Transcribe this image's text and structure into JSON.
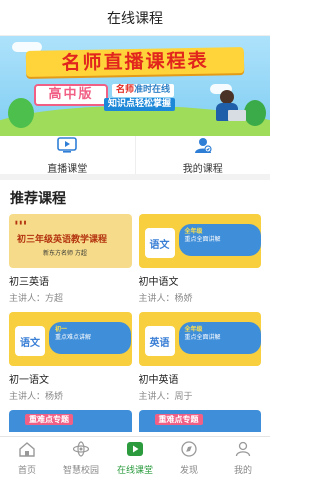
{
  "header": {
    "title": "在线课程"
  },
  "banner": {
    "headline": "名师直播课程表",
    "grade_badge": "高中版",
    "line1_prefix": "名师",
    "line1_rest": "准时在线",
    "line2": "知识点轻松掌握"
  },
  "quick_nav": [
    {
      "label": "直播课堂",
      "icon": "tv-icon"
    },
    {
      "label": "我的课程",
      "icon": "user-icon"
    }
  ],
  "recommend": {
    "title": "推荐课程",
    "teacher_prefix": "主讲人：",
    "courses": [
      {
        "name": "初三英语",
        "teacher": "方超",
        "thumb_title": "初三年级英语教学课程",
        "thumb_sub": "新东方名师 方超",
        "style": "yellow"
      },
      {
        "name": "初中语文",
        "teacher": "杨娇",
        "thumb_title": "语文",
        "thumb_sub": "重点全面讲解",
        "thumb_tag": "全年级",
        "style": "yellow"
      },
      {
        "name": "初一语文",
        "teacher": "杨娇",
        "thumb_title": "语文",
        "thumb_sub": "重点难点讲解",
        "thumb_tag": "初一",
        "style": "yellow"
      },
      {
        "name": "初中英语",
        "teacher": "周于",
        "thumb_title": "英语",
        "thumb_sub": "重点全面讲解",
        "thumb_tag": "全年级",
        "style": "yellow"
      }
    ],
    "next_row_tags": [
      "重难点专题",
      "重难点专题"
    ]
  },
  "tabbar": {
    "active_color": "#2b9b3d",
    "items": [
      {
        "label": "首页",
        "icon": "home-icon",
        "active": false
      },
      {
        "label": "智慧校园",
        "icon": "campus-icon",
        "active": false
      },
      {
        "label": "在线课堂",
        "icon": "play-icon",
        "active": true
      },
      {
        "label": "发现",
        "icon": "compass-icon",
        "active": false
      },
      {
        "label": "我的",
        "icon": "profile-icon",
        "active": false
      }
    ]
  }
}
